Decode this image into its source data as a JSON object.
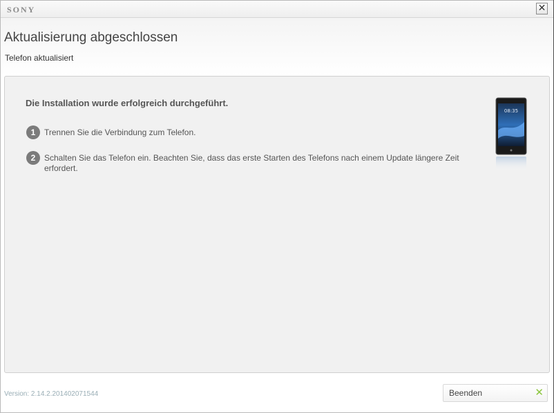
{
  "window": {
    "logo": "SONY",
    "close_glyph": "✕",
    "close_icon": "close-icon"
  },
  "header": {
    "title": "Aktualisierung abgeschlossen",
    "subtitle": "Telefon aktualisiert"
  },
  "content": {
    "heading": "Die Installation wurde erfolgreich durchgeführt.",
    "steps": [
      {
        "number": "1",
        "text": "Trennen Sie die Verbindung zum Telefon."
      },
      {
        "number": "2",
        "text": "Schalten Sie das Telefon ein. Beachten Sie, dass das erste Starten des Telefons nach einem Update längere Zeit erfordert."
      }
    ],
    "phone_icon": "phone-icon"
  },
  "footer": {
    "version": "Version: 2.14.2.201402071544",
    "finish_label": "Beenden",
    "check_glyph": "✕",
    "check_icon": "check-icon"
  },
  "colors": {
    "accent_green": "#8cc63f",
    "panel_bg": "#f1f1f1",
    "text_gray": "#555555",
    "version_text": "#9aaeb6"
  }
}
